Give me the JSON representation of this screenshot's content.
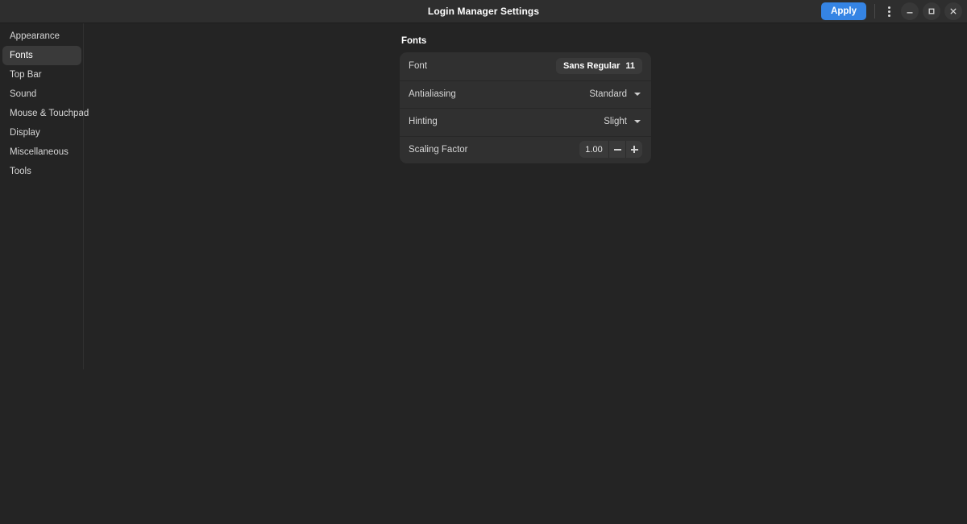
{
  "window": {
    "title": "Login Manager Settings",
    "apply_label": "Apply",
    "menu_icon": "kebab-menu-icon",
    "minimize_icon": "minimize-icon",
    "maximize_icon": "maximize-icon",
    "close_icon": "close-icon",
    "accent_color": "#3584e4"
  },
  "sidebar": {
    "items": [
      {
        "label": "Appearance",
        "selected": false
      },
      {
        "label": "Fonts",
        "selected": true
      },
      {
        "label": "Top Bar",
        "selected": false
      },
      {
        "label": "Sound",
        "selected": false
      },
      {
        "label": "Mouse & Touchpad",
        "selected": false
      },
      {
        "label": "Display",
        "selected": false
      },
      {
        "label": "Miscellaneous",
        "selected": false
      },
      {
        "label": "Tools",
        "selected": false
      }
    ]
  },
  "main": {
    "section_title": "Fonts",
    "rows": {
      "font": {
        "label": "Font",
        "value_name": "Sans Regular",
        "value_size": "11"
      },
      "antialiasing": {
        "label": "Antialiasing",
        "value": "Standard"
      },
      "hinting": {
        "label": "Hinting",
        "value": "Slight"
      },
      "scaling": {
        "label": "Scaling Factor",
        "value": "1.00",
        "decrement_label": "−",
        "increment_label": "+"
      }
    }
  }
}
